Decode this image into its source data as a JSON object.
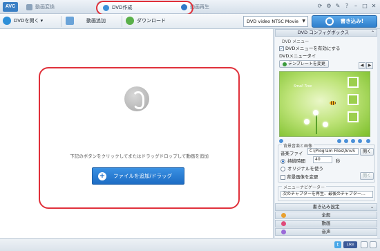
{
  "app": {
    "logo": "AVC"
  },
  "tabs": [
    {
      "label": "動画変換"
    },
    {
      "label": "DVD作成"
    },
    {
      "label": "動画再生"
    }
  ],
  "toolbar": {
    "open_dvd": "DVDを開く",
    "add_video": "動画追加",
    "download": "ダウンロード",
    "profile": "DVD video NTSC Movie",
    "burn": "書き込み!"
  },
  "main": {
    "instruction": "下記のボタンをクリックしてまたはドラッグドロップして動画を追加",
    "add_button": "ファイルを追加/ドラッグ"
  },
  "panel": {
    "header": "DVD コンフィグボックス",
    "menu_section": "DVD メニュー",
    "enable_menu": "DVDメニューを有効にする",
    "enable_menu_checked": true,
    "menu_title_label": "DVDメニュータイ",
    "template_button": "テンプレートを変更",
    "preview_caption": "Small Tree",
    "bg_section": "背景音楽と画像",
    "music_label": "音楽ファイ",
    "music_path": "C:\\Program Files\\AnvS",
    "open_button": "開く",
    "duration_label": "持続時間",
    "duration_value": "40",
    "duration_unit": "秒",
    "original_label": "オリジナルを使う",
    "change_bg_label": "背景画像を変更",
    "open_button2": "開く",
    "nav_section": "メニューナビゲーター",
    "nav_value": "次のチャプターを再生、最後のチャプター…",
    "bars": [
      {
        "label": "書き込み設定",
        "color": ""
      },
      {
        "label": "全般",
        "color": "#e8a030"
      },
      {
        "label": "動画",
        "color": "#e04a7a"
      },
      {
        "label": "音声",
        "color": "#9a6ad8"
      }
    ]
  },
  "status": {
    "like": "Like"
  },
  "colors": {
    "accent": "#2f7fcc",
    "highlight": "#e0303a"
  }
}
